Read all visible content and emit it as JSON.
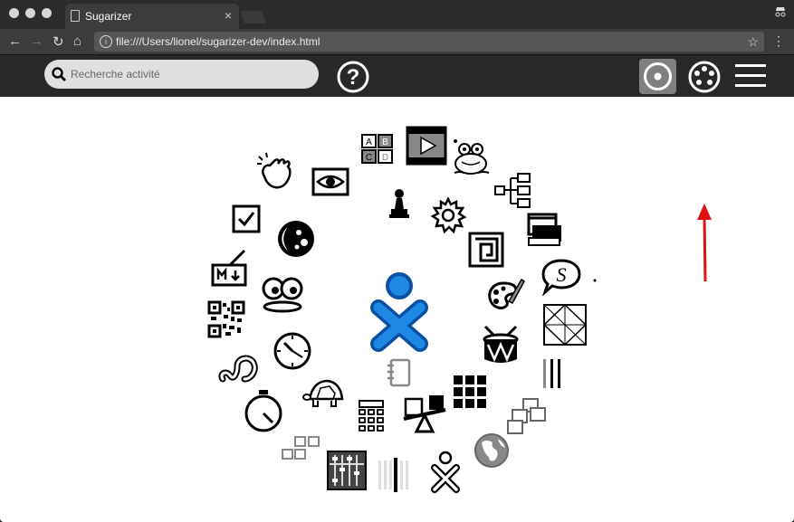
{
  "browser": {
    "tab_title": "Sugarizer",
    "tab_close": "×",
    "address": "file:///Users/lionel/sugarizer-dev/index.html",
    "back": "←",
    "forward": "→",
    "reload": "↻",
    "home": "⌂",
    "info": "i",
    "star": "☆",
    "menu": "⋮"
  },
  "toolbar": {
    "search_placeholder": "Recherche activité",
    "help_icon": "?"
  },
  "activities": [
    "abcd",
    "video",
    "frog",
    "mindmap",
    "printer-book",
    "speech-s",
    "origami-square",
    "vertical-lines",
    "photos-stack",
    "globe",
    "xo-small",
    "lines-pattern",
    "thin-vertical-bar",
    "abacus",
    "small-squares",
    "stopwatch",
    "worm",
    "qr-code",
    "markdown",
    "checkbox",
    "clapping-hands",
    "eye",
    "chess-pawn",
    "gear",
    "maze",
    "moon",
    "eyes",
    "clock",
    "turtle",
    "calculator",
    "seesaw",
    "grid-blocks",
    "drum",
    "paint-palette",
    "notebook"
  ],
  "annotation": {
    "arrow_color": "#e11111"
  },
  "colors": {
    "xo_fill": "#1e88e5",
    "xo_stroke": "#0b4ea2"
  }
}
